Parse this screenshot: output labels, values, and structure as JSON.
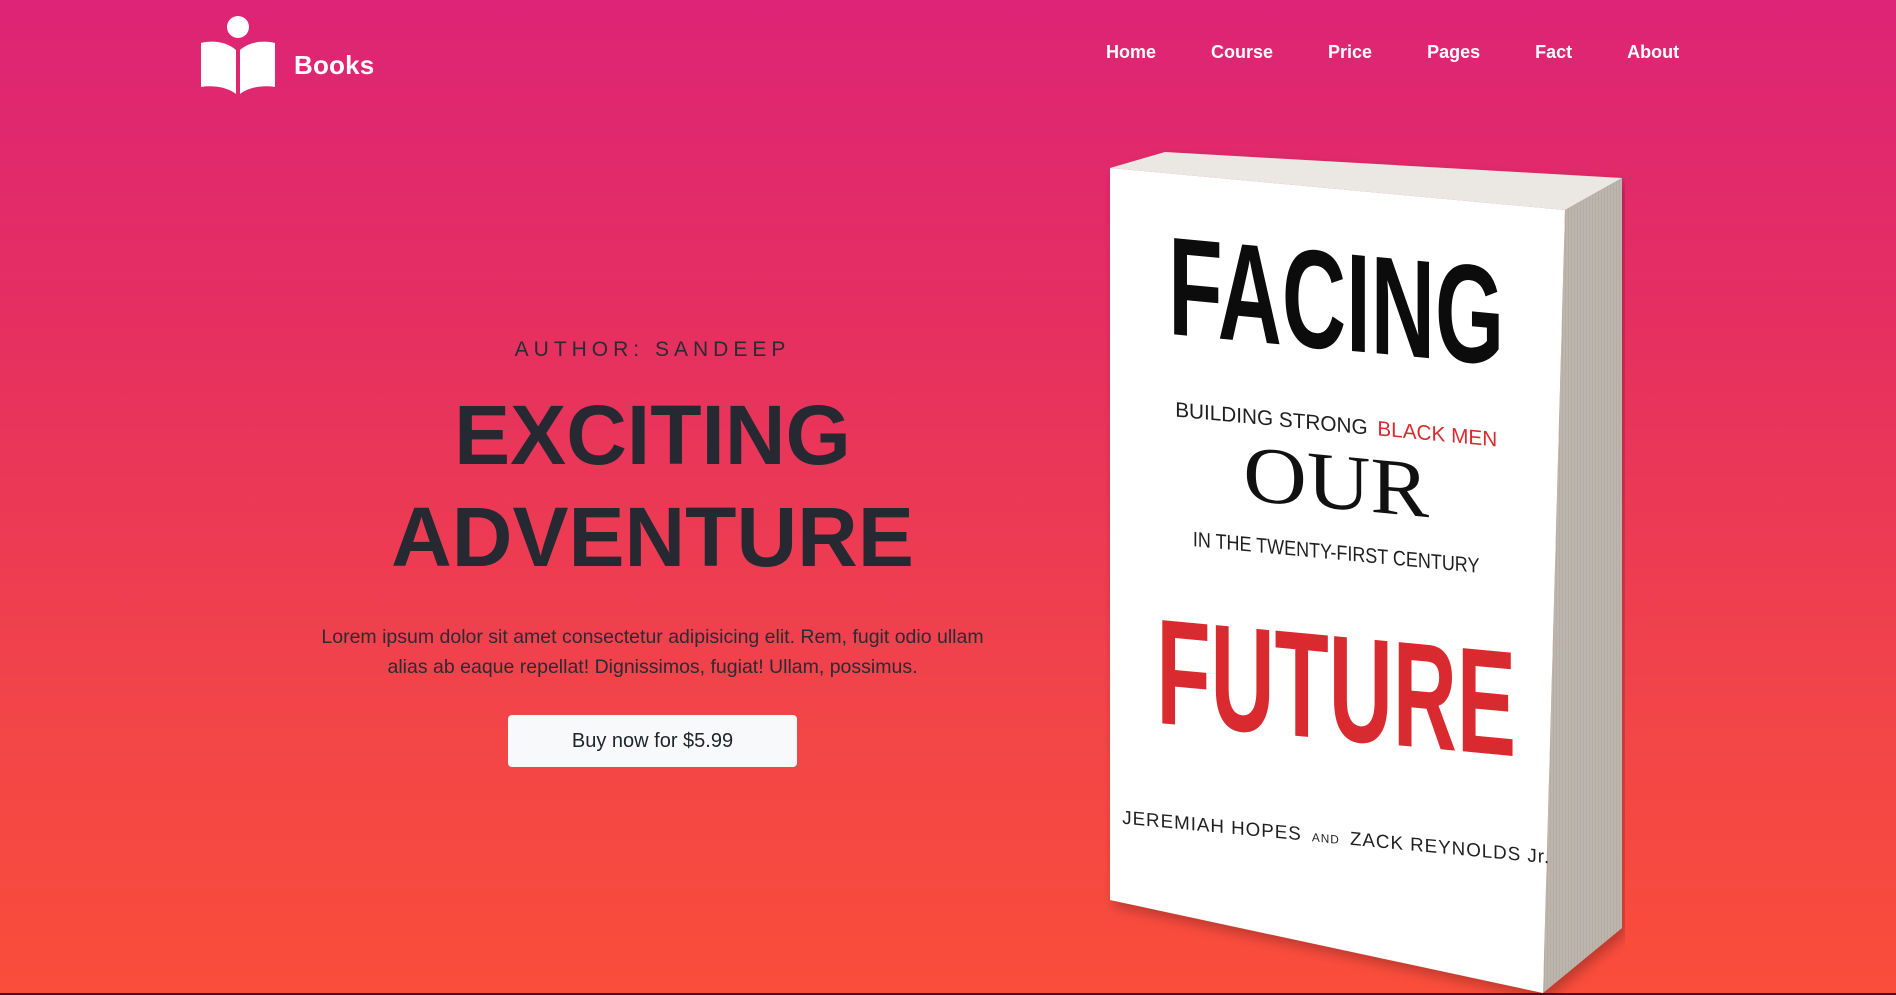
{
  "brand": {
    "name": "Books",
    "logo_icon": "reading-person-open-book-icon"
  },
  "nav": {
    "items": [
      "Home",
      "Course",
      "Price",
      "Pages",
      "Fact",
      "About"
    ]
  },
  "hero": {
    "author": "AUTHOR: SANDEEP",
    "title_line1": "EXCITING",
    "title_line2": "ADVENTURE",
    "description": "Lorem ipsum dolor sit amet consectetur adipisicing elit. Rem, fugit odio ullam alias ab eaque repellat! Dignissimos, fugiat! Ullam, possimus.",
    "cta_label": "Buy now for $5.99"
  },
  "book": {
    "title_top": "FACING",
    "subtitle_part1": "BUILDING STRONG",
    "subtitle_part2": "BLACK MEN",
    "title_middle": "OUR",
    "subtitle_line2": "IN THE TWENTY-FIRST CENTURY",
    "title_bottom": "FUTURE",
    "authors_part1": "JEREMIAH HOPES",
    "authors_and": "AND",
    "authors_part2": "ZACK REYNOLDS Jr."
  },
  "colors": {
    "gradient_top": "#dd2476",
    "gradient_bottom": "#fa4d3a",
    "text_dark": "#272932",
    "book_red": "#d92b2f",
    "button_bg": "#f8f9fa"
  }
}
